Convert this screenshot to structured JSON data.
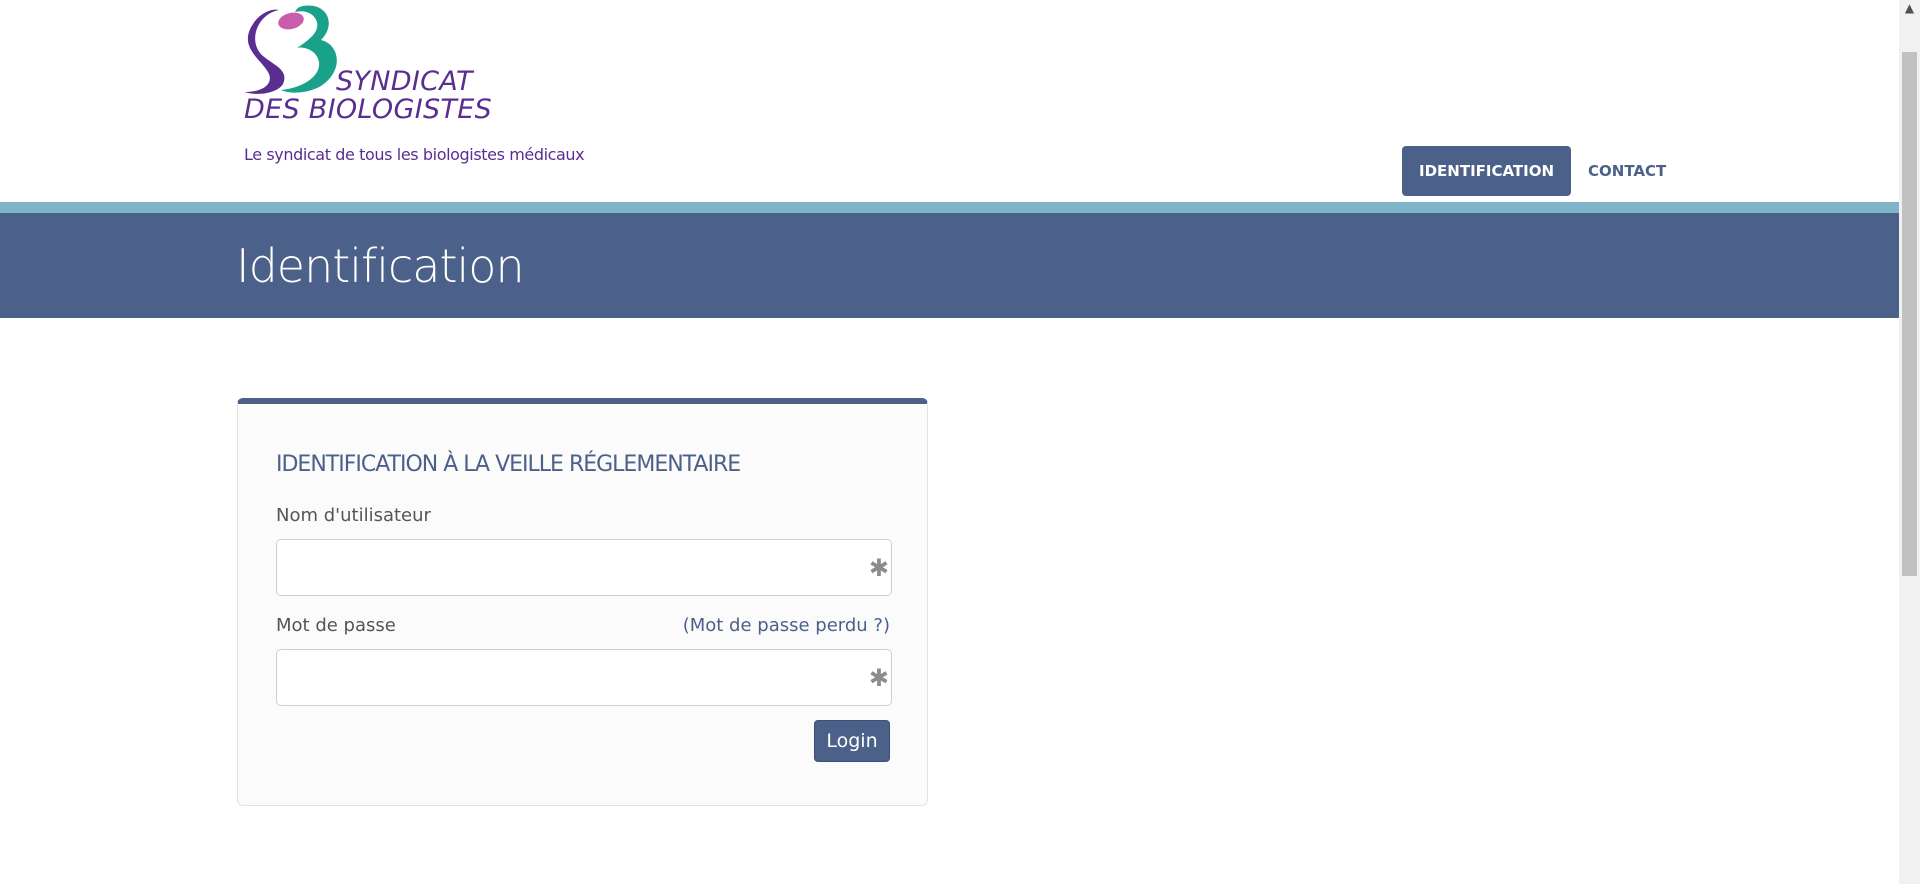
{
  "logo": {
    "name_line1": "SYNDICAT",
    "name_line2": "DES BIOLOGISTES",
    "tagline": "Le syndicat de tous les biologistes médicaux"
  },
  "nav": {
    "items": [
      {
        "label": "IDENTIFICATION",
        "active": true
      },
      {
        "label": "CONTACT",
        "active": false
      }
    ]
  },
  "page": {
    "title": "Identification"
  },
  "login_form": {
    "heading": "IDENTIFICATION À LA VEILLE RÉGLEMENTAIRE",
    "username_label": "Nom d'utilisateur",
    "username_value": "",
    "password_label": "Mot de passe",
    "password_value": "",
    "lost_password_link": "(Mot de passe perdu ?)",
    "required_icon": "asterisk-icon",
    "submit_label": "Login"
  },
  "colors": {
    "primary": "#4c6189",
    "teal_bar": "#7fb5c9",
    "logo_purple": "#5a2d91",
    "logo_green": "#1aa189",
    "logo_pink": "#c95cab"
  }
}
